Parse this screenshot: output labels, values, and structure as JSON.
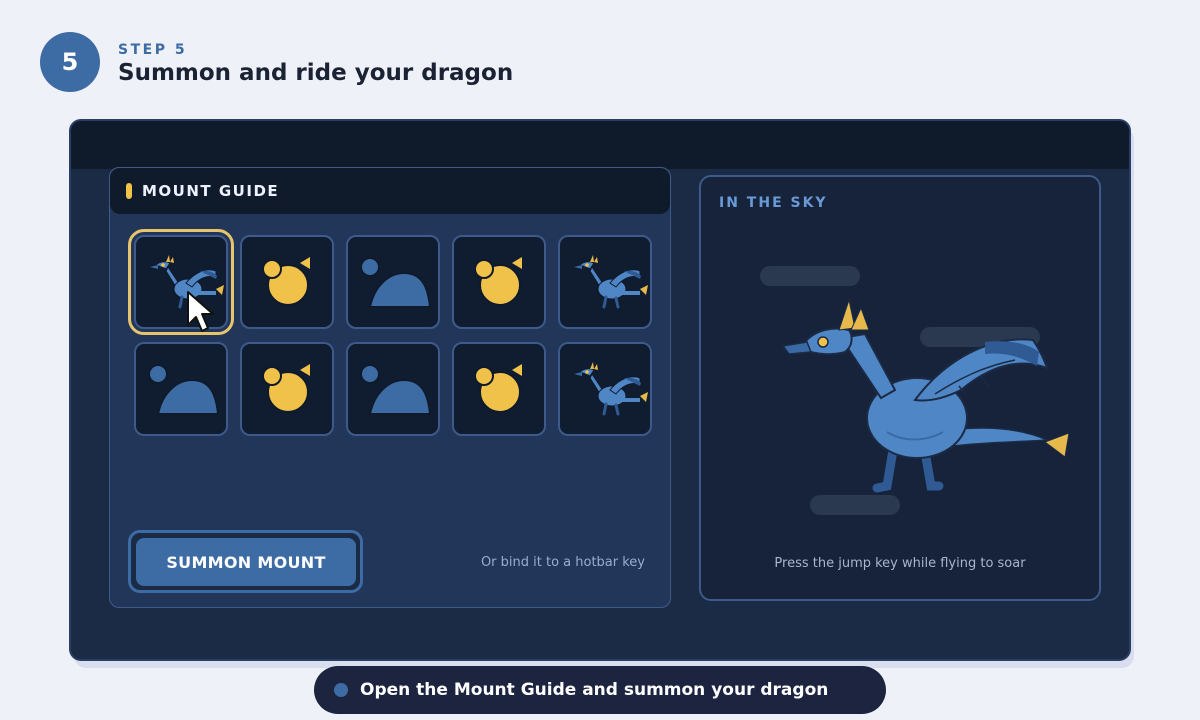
{
  "step": {
    "number": "5",
    "label": "STEP 5",
    "title": "Summon and ride your dragon"
  },
  "mount_guide": {
    "title": "MOUNT GUIDE",
    "slots": [
      {
        "icon": "dragon-icon",
        "selected": true
      },
      {
        "icon": "sun-orb-icon"
      },
      {
        "icon": "mountain-mount-icon"
      },
      {
        "icon": "sun-orb-icon"
      },
      {
        "icon": "dragon-icon"
      },
      {
        "icon": "mountain-mount-icon"
      },
      {
        "icon": "sun-orb-icon"
      },
      {
        "icon": "mountain-mount-icon"
      },
      {
        "icon": "sun-orb-icon"
      },
      {
        "icon": "dragon-icon"
      }
    ],
    "summon_button": "SUMMON MOUNT",
    "hint": "Or bind it to a hotbar key"
  },
  "sky_panel": {
    "title": "IN THE SKY",
    "caption": "Press the jump key while flying to soar"
  },
  "instruction": "Open the Mount Guide and summon your dragon",
  "colors": {
    "accent_blue": "#3d6ba3",
    "accent_gold": "#f1c24a",
    "dragon_blue": "#4f86c6",
    "window_bg": "#1b2a45"
  }
}
